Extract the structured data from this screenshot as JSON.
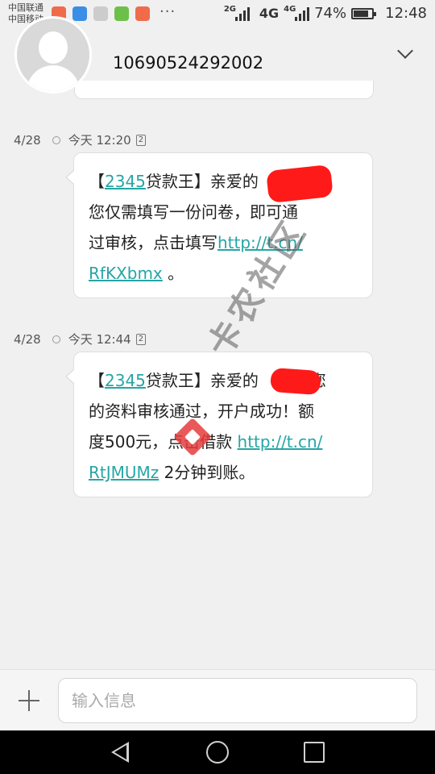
{
  "status_bar": {
    "carrier_1": "中国联通",
    "carrier_2": "中国移动",
    "more": "···",
    "net_1": "2G",
    "net_2": "4G",
    "net_3": "4G",
    "battery_text": "74%",
    "battery_level": 0.74,
    "time": "12:48",
    "app_icon_colors": [
      "#f06b4a",
      "#3a8ee6",
      "#cccccc",
      "#6cc04a",
      "#f06b4a"
    ]
  },
  "header": {
    "contact": "10690524292002",
    "expand_icon": "chevron-down-icon",
    "avatar_icon": "person-avatar-icon"
  },
  "messages": [
    {
      "date": "4/28",
      "time": "今天 12:20",
      "sim": "2",
      "lines": {
        "l1_pre": "【",
        "l1_link": "2345",
        "l1_post": "贷款王】亲爱的",
        "l2": "您仅需填写一份问卷，即可通",
        "l3_pre": "过审核，点击填写",
        "l3_link": "http://t.cn/",
        "l4_link": "RfKXbmx",
        "l4_post": " 。"
      }
    },
    {
      "date": "4/28",
      "time": "今天 12:44",
      "sim": "2",
      "lines": {
        "l1_pre": "【",
        "l1_link": "2345",
        "l1_post": "贷款王】亲爱的",
        "l1_end": "您",
        "l2": "的资料审核通过，开户成功！额",
        "l3_pre": "度500元，点击借款 ",
        "l3_link": "http://t.cn/",
        "l4_link": "RtJMUMz",
        "l4_post": " 2分钟到账。"
      }
    }
  ],
  "watermark": "卡农社区",
  "input": {
    "placeholder": "输入信息",
    "add_icon": "plus-icon"
  },
  "nav": {
    "back_icon": "back-icon",
    "home_icon": "home-icon",
    "recent_icon": "recent-apps-icon"
  },
  "colors": {
    "link": "#26a5a5",
    "redaction": "#ff1a1a",
    "background": "#f0f0f0"
  }
}
